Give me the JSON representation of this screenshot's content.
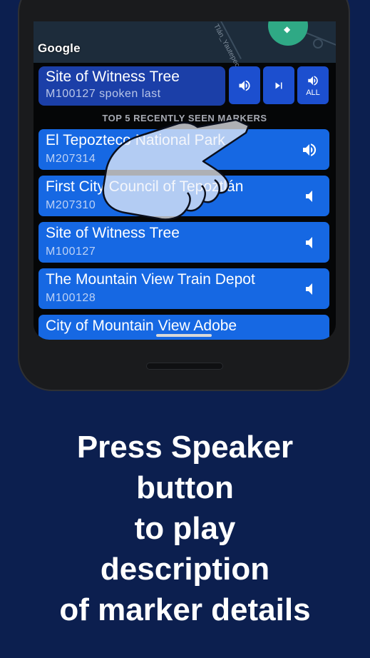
{
  "map": {
    "attribution": "Google",
    "street_label": "Tlán_Yautepec"
  },
  "now_speaking": {
    "title": "Site of Witness Tree",
    "subtitle": "M100127 spoken last"
  },
  "controls": {
    "speak_icon": "speaker-icon",
    "skip_icon": "skip-next-icon",
    "speak_all_icon": "speaker-icon",
    "speak_all_label": "ALL"
  },
  "section_header": "TOP 5 RECENTLY SEEN MARKERS",
  "markers": [
    {
      "title": "El Tepozteco National Park",
      "id": "M207314",
      "speaker": "speaker-loud-icon"
    },
    {
      "title": "First City Council of Tepoztlán",
      "id": "M207310",
      "speaker": "speaker-quiet-icon"
    },
    {
      "title": "Site of Witness Tree",
      "id": "M100127",
      "speaker": "speaker-quiet-icon"
    },
    {
      "title": "The Mountain View Train Depot",
      "id": "M100128",
      "speaker": "speaker-quiet-icon"
    },
    {
      "title": "City of Mountain View Adobe",
      "id": "",
      "speaker": ""
    }
  ],
  "caption": {
    "line1": "Press Speaker",
    "line2": "button",
    "line3": "to play",
    "line4": "description",
    "line5": "of marker details"
  },
  "colors": {
    "background": "#0c1f4f",
    "list_item": "#1668e3",
    "now_card": "#1b3fa8",
    "map_fab": "#2fa985"
  }
}
